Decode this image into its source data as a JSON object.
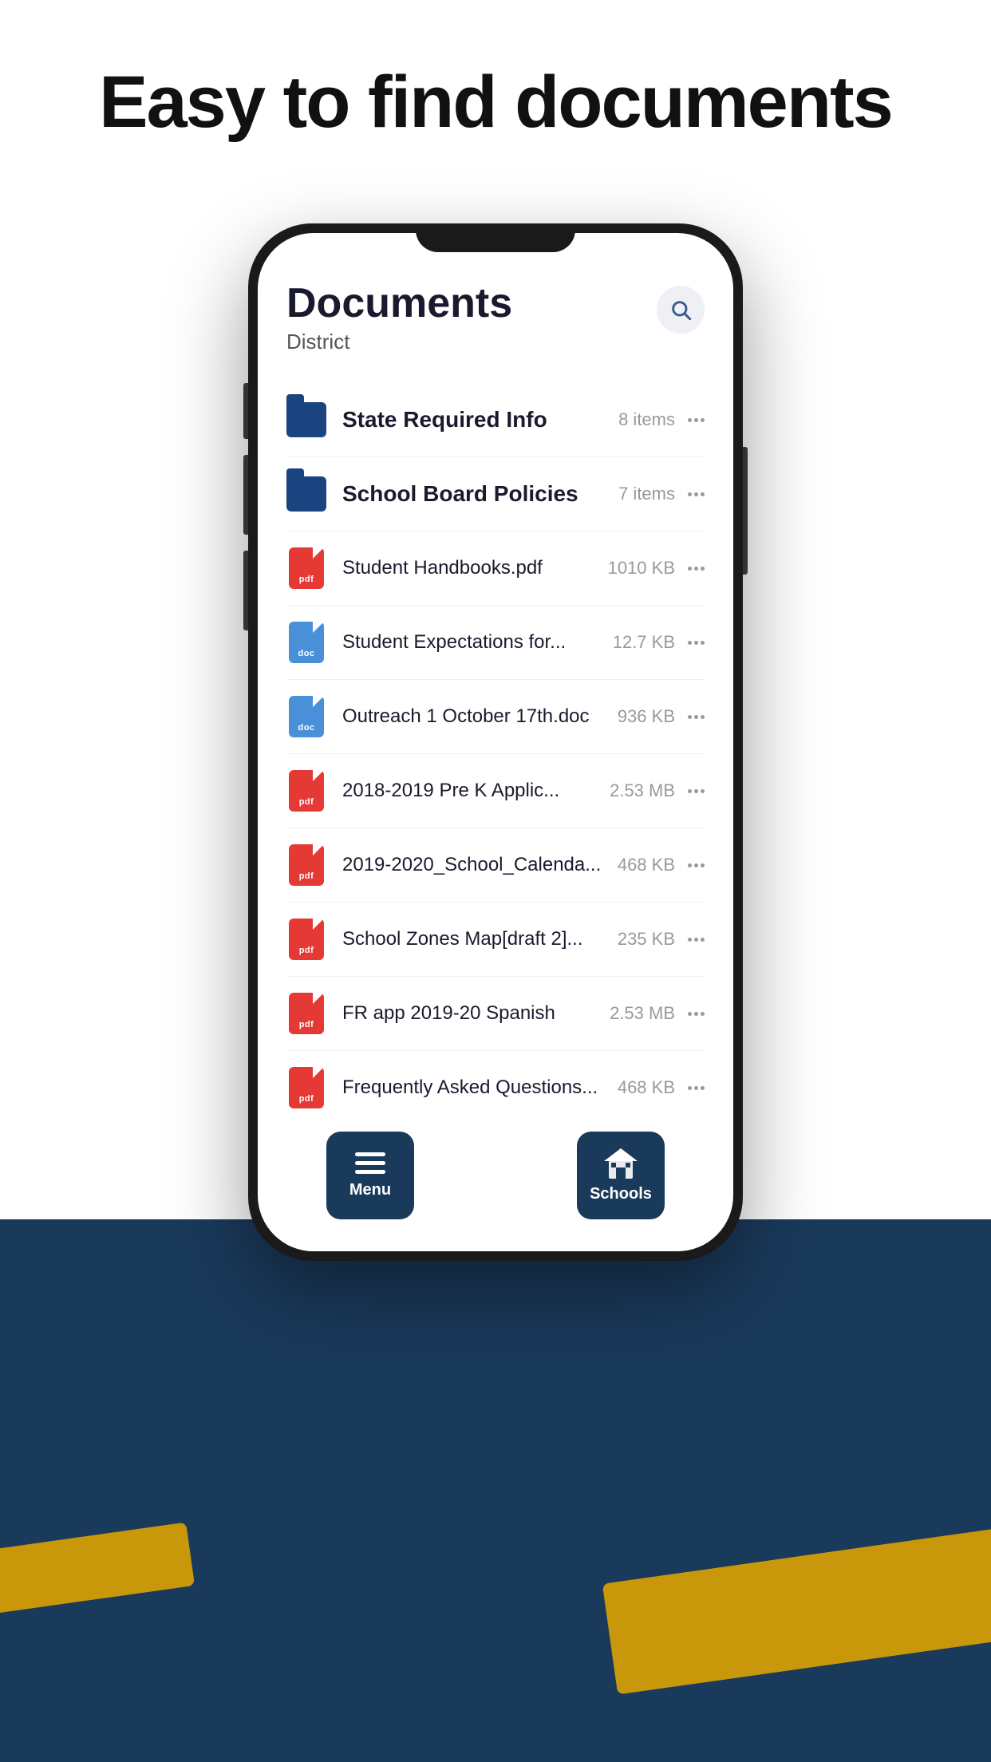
{
  "page": {
    "headline": "Easy to find documents",
    "background_color": "#ffffff",
    "bottom_color": "#1a3a5c"
  },
  "screen": {
    "title": "Documents",
    "subtitle": "District",
    "search_icon": "search-icon"
  },
  "items": [
    {
      "type": "folder",
      "name": "State Required Info",
      "meta": "8 items",
      "bold": true
    },
    {
      "type": "folder",
      "name": "School Board Policies",
      "meta": "7 items",
      "bold": true
    },
    {
      "type": "pdf",
      "name": "Student Handbooks.pdf",
      "meta": "1010 KB",
      "bold": false
    },
    {
      "type": "doc",
      "name": "Student Expectations for...",
      "meta": "12.7 KB",
      "bold": false
    },
    {
      "type": "doc",
      "name": "Outreach 1 October 17th.doc",
      "meta": "936 KB",
      "bold": false
    },
    {
      "type": "pdf",
      "name": "2018-2019 Pre K Applic...",
      "meta": "2.53 MB",
      "bold": false
    },
    {
      "type": "pdf",
      "name": "2019-2020_School_Calenda...",
      "meta": "468 KB",
      "bold": false
    },
    {
      "type": "pdf",
      "name": "School Zones Map[draft 2]...",
      "meta": "235 KB",
      "bold": false
    },
    {
      "type": "pdf",
      "name": "FR app 2019-20 Spanish",
      "meta": "2.53 MB",
      "bold": false
    },
    {
      "type": "pdf",
      "name": "Frequently Asked Questions...",
      "meta": "468 KB",
      "bold": false
    }
  ],
  "nav": {
    "menu_label": "Menu",
    "schools_label": "Schools"
  }
}
